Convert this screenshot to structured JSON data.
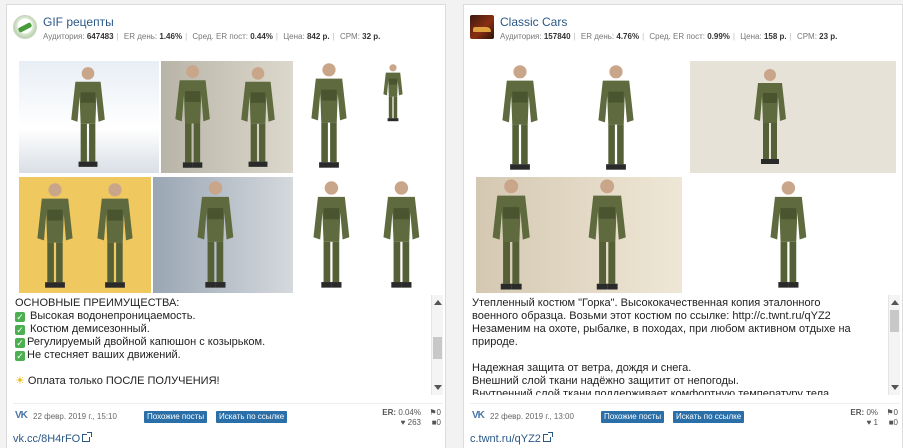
{
  "posts": [
    {
      "group": {
        "name": "GIF рецепты",
        "avatar": "gif-recipes-logo"
      },
      "stats": {
        "audience_label": "Аудитория:",
        "audience": "647483",
        "er_day_label": "ER день:",
        "er_day": "1.46%",
        "er_avg_label": "Сред. ER пост:",
        "er_avg": "0.44%",
        "price_label": "Цена:",
        "price": "842 р.",
        "cpm_label": "CPM:",
        "cpm": "32 р."
      },
      "text_lines": [
        {
          "icon": "",
          "text": "ОСНОВНЫЕ ПРЕИМУЩЕСТВА:"
        },
        {
          "icon": "check-mark-icon",
          "text": " Высокая водонепроницаемость."
        },
        {
          "icon": "check-mark-icon",
          "text": " Костюм демисезонный."
        },
        {
          "icon": "check-mark-icon",
          "text": "Регулируемый двойной капюшон с козырьком."
        },
        {
          "icon": "check-mark-icon",
          "text": "Не стесняет ваших движений."
        },
        {
          "icon": "",
          "text": ""
        },
        {
          "icon": "sun-icon",
          "text": " Оплата только ПОСЛЕ ПОЛУЧЕНИЯ!"
        }
      ],
      "date": "22 февр. 2019 г., 15:10",
      "buttons": {
        "similar": "Похожие посты",
        "search": "Искать по ссылке"
      },
      "metrics": {
        "er_label": "ER:",
        "er": "0.04%",
        "reposts": "0",
        "likes": "263",
        "comments": "0"
      },
      "link": "vk.cc/8H4rFO",
      "scroll_fraction": 0.55
    },
    {
      "group": {
        "name": "Classic Cars",
        "avatar": "classic-cars-logo"
      },
      "stats": {
        "audience_label": "Аудитория:",
        "audience": "157840",
        "er_day_label": "ER день:",
        "er_day": "4.76%",
        "er_avg_label": "Сред. ER пост:",
        "er_avg": "0.99%",
        "price_label": "Цена:",
        "price": "158 р.",
        "cpm_label": "CPM:",
        "cpm": "23 р."
      },
      "text_lines": [
        {
          "icon": "",
          "text": "Утепленный костюм \"Горка\". Высококачественная копия эталонного"
        },
        {
          "icon": "",
          "text": "военного образца. Возьми этот костюм по ссылке: http://c.twnt.ru/qYZ2"
        },
        {
          "icon": "",
          "text": "Незаменим на охоте, рыбалке, в походах, при любом активном отдыхе на"
        },
        {
          "icon": "",
          "text": "природе."
        },
        {
          "icon": "",
          "text": ""
        },
        {
          "icon": "",
          "text": "Надежная защита от ветра, дождя и снега."
        },
        {
          "icon": "",
          "text": "Внешний слой ткани надёжно защитит от непогоды."
        },
        {
          "icon": "",
          "text": "Внутренний слой ткани поддерживает комфортную температуру тела"
        }
      ],
      "date": "22 февр. 2019 г., 13:00",
      "buttons": {
        "similar": "Похожие посты",
        "search": "Искать по ссылке"
      },
      "metrics": {
        "er_label": "ER:",
        "er": "0%",
        "reposts": "0",
        "likes": "1",
        "comments": "0"
      },
      "link": "c.twnt.ru/qYZ2",
      "scroll_fraction": 0.05
    }
  ],
  "colors": {
    "link": "#2a5885",
    "button": "#2a6fa8",
    "check": "#4caf50",
    "suit": "#5f6b3e"
  }
}
